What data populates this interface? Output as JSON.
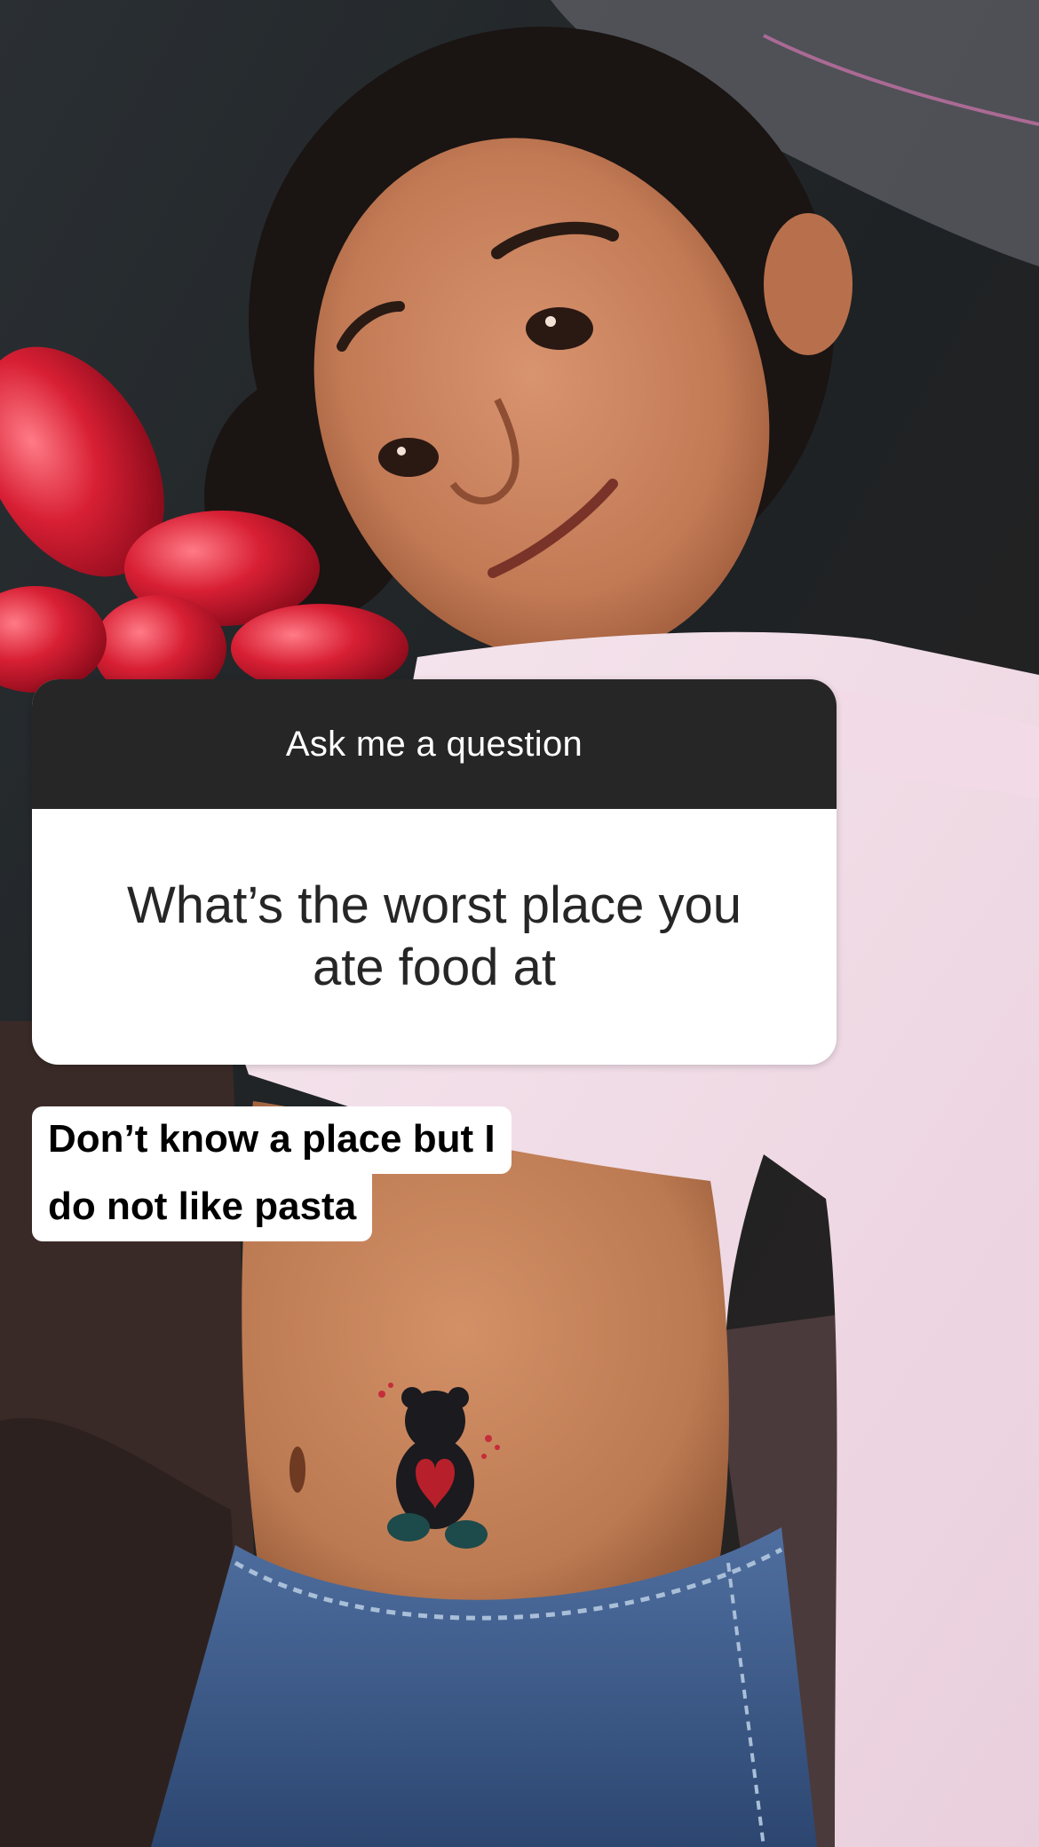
{
  "story": {
    "background_description_icon": "photo",
    "question_sticker": {
      "header": "Ask me a question",
      "question": "What’s the worst place you ate food at",
      "header_color": "#262626",
      "body_color": "#ffffff"
    },
    "answer": {
      "lines": [
        "Don’t know a place but I",
        "do not like pasta"
      ]
    }
  }
}
